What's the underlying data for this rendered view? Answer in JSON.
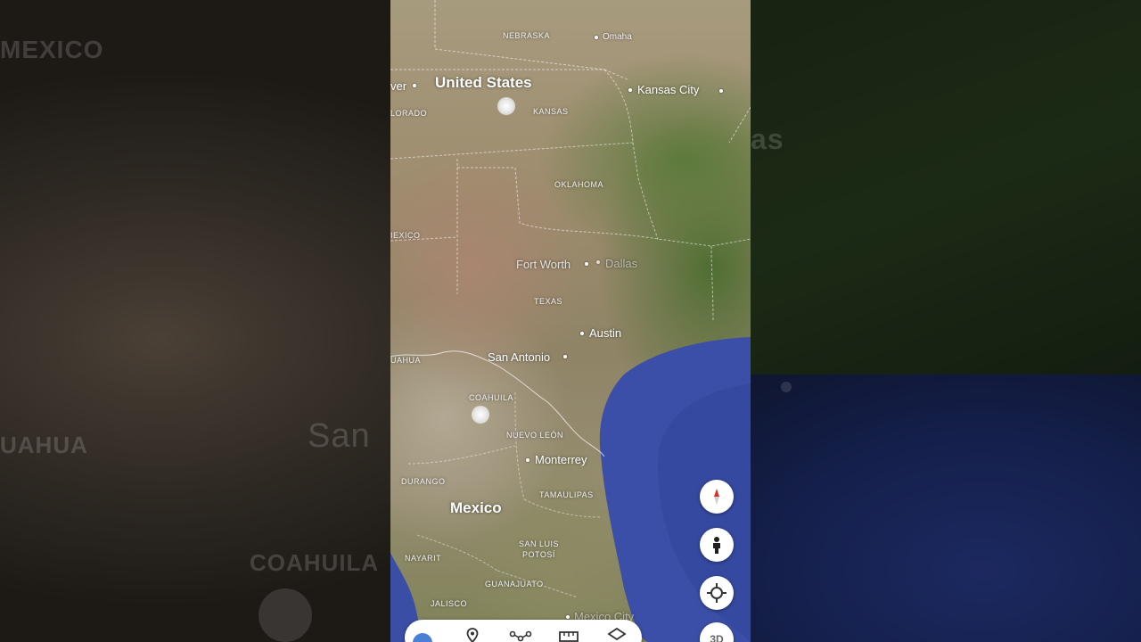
{
  "background_labels": {
    "top_left": "MEXICO",
    "right_partial": "as",
    "left_mid": "UAHUA",
    "left_mid_city": "San",
    "left_bottom": "COAHUILA"
  },
  "map": {
    "labels": {
      "country_us": "United States",
      "country_mexico": "Mexico",
      "nebraska": "NEBRASKA",
      "omaha": "Omaha",
      "denver_partial": "ver",
      "colorado_partial": "LORADO",
      "kansas": "KANSAS",
      "kansas_city": "Kansas City",
      "oklahoma": "OKLAHOMA",
      "new_mexico_partial": "IEXICO",
      "fort_worth": "Fort Worth",
      "dallas": "Dallas",
      "texas": "TEXAS",
      "austin": "Austin",
      "chihuahua_partial": "UAHUA",
      "san_antonio": "San Antonio",
      "coahuila": "COAHUILA",
      "nuevo_leon": "NUEVO LEÓN",
      "monterrey": "Monterrey",
      "durango": "DURANGO",
      "tamaulipas": "TAMAULIPAS",
      "san_luis_potosi_1": "SAN LUIS",
      "san_luis_potosi_2": "POTOSÍ",
      "nayarit": "NAYARIT",
      "guanajuato": "GUANAJUATO",
      "jalisco": "JALISCO",
      "mexico_city": "Mexico City"
    }
  },
  "controls": {
    "compass": "compass-icon",
    "street_view": "pegman-icon",
    "my_location": "crosshair-icon",
    "view_3d_label": "3D"
  },
  "toolbar": {
    "items": [
      "earth-icon",
      "place-pin-icon",
      "path-icon",
      "ruler-icon",
      "layers-icon"
    ]
  },
  "colors": {
    "water": "#3b4fa8",
    "compass_red": "#d93025"
  }
}
